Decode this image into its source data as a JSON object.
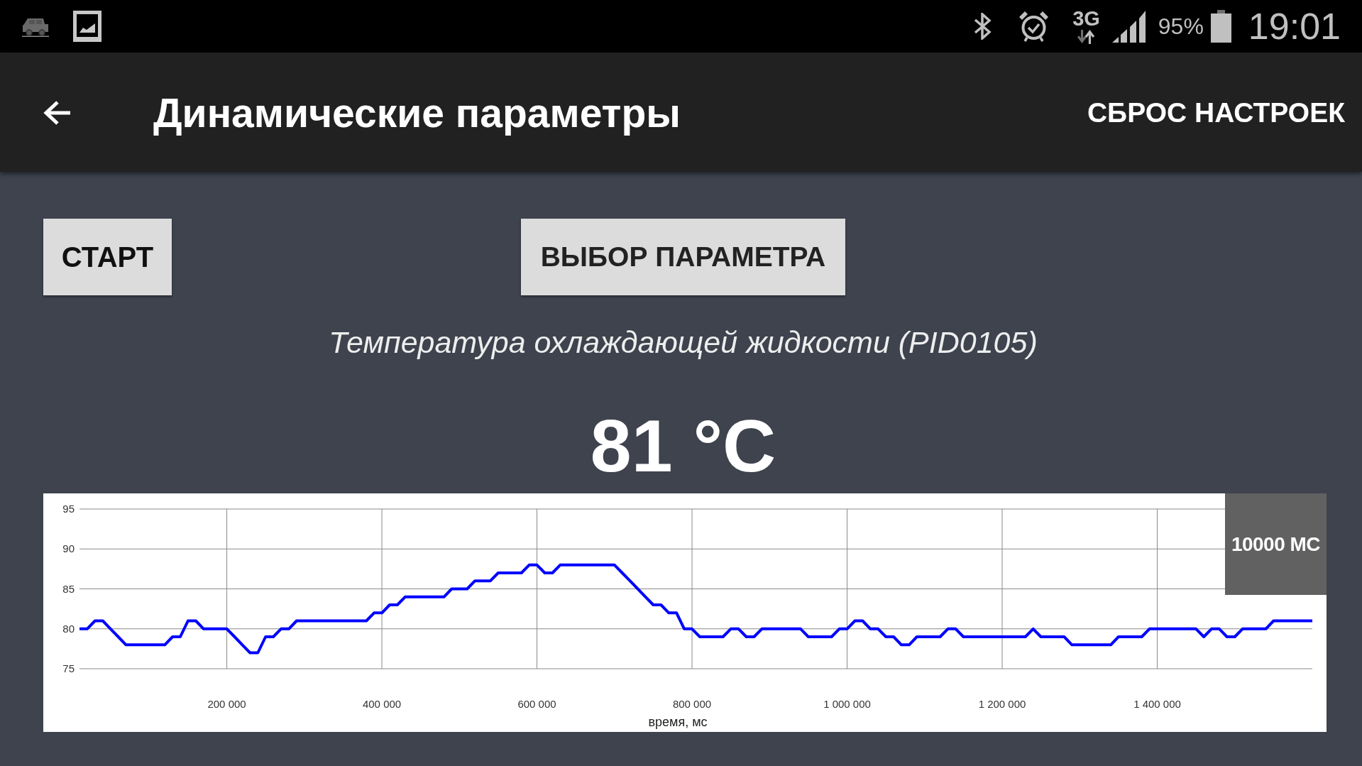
{
  "status_bar": {
    "network": "3G",
    "battery": "95%",
    "time": "19:01"
  },
  "app_bar": {
    "title": "Динамические параметры",
    "action": "СБРОС НАСТРОЕК"
  },
  "toolbar": {
    "start_button": "СТАРТ",
    "select_button": "ВЫБОР ПАРАМЕТРА"
  },
  "parameter": {
    "name": "Температура охлаждающей жидкости (PID0105)",
    "value": "81 °C"
  },
  "chart": {
    "interval": "10000 МС",
    "chart_data": {
      "type": "line",
      "xlabel": "время, мс",
      "grid": true,
      "xlim": [
        10000,
        1600000
      ],
      "ylim": [
        75,
        95
      ],
      "xticks": [
        {
          "value": 200000,
          "label": "200 000"
        },
        {
          "value": 400000,
          "label": "400 000"
        },
        {
          "value": 600000,
          "label": "600 000"
        },
        {
          "value": 800000,
          "label": "800 000"
        },
        {
          "value": 1000000,
          "label": "1 000 000"
        },
        {
          "value": 1200000,
          "label": "1 200 000"
        },
        {
          "value": 1400000,
          "label": "1 400 000"
        }
      ],
      "yticks": [
        75,
        80,
        85,
        90,
        95
      ],
      "x": [
        10000,
        20000,
        30000,
        40000,
        50000,
        60000,
        70000,
        80000,
        90000,
        100000,
        110000,
        120000,
        130000,
        140000,
        150000,
        160000,
        170000,
        180000,
        190000,
        200000,
        210000,
        220000,
        230000,
        240000,
        250000,
        260000,
        270000,
        280000,
        290000,
        300000,
        310000,
        320000,
        330000,
        340000,
        350000,
        360000,
        370000,
        380000,
        390000,
        400000,
        410000,
        420000,
        430000,
        440000,
        450000,
        460000,
        470000,
        480000,
        490000,
        500000,
        510000,
        520000,
        530000,
        540000,
        550000,
        560000,
        570000,
        580000,
        590000,
        600000,
        610000,
        620000,
        630000,
        640000,
        650000,
        660000,
        670000,
        680000,
        690000,
        700000,
        710000,
        720000,
        730000,
        740000,
        750000,
        760000,
        770000,
        780000,
        790000,
        800000,
        810000,
        820000,
        830000,
        840000,
        850000,
        860000,
        870000,
        880000,
        890000,
        900000,
        910000,
        920000,
        930000,
        940000,
        950000,
        960000,
        970000,
        980000,
        990000,
        1000000,
        1010000,
        1020000,
        1030000,
        1040000,
        1050000,
        1060000,
        1070000,
        1080000,
        1090000,
        1100000,
        1110000,
        1120000,
        1130000,
        1140000,
        1150000,
        1160000,
        1170000,
        1180000,
        1190000,
        1200000,
        1210000,
        1220000,
        1230000,
        1240000,
        1250000,
        1260000,
        1270000,
        1280000,
        1290000,
        1300000,
        1310000,
        1320000,
        1330000,
        1340000,
        1350000,
        1360000,
        1370000,
        1380000,
        1390000,
        1400000,
        1410000,
        1420000,
        1430000,
        1440000,
        1450000,
        1460000,
        1470000,
        1480000,
        1490000,
        1500000,
        1510000,
        1520000,
        1530000,
        1540000,
        1550000,
        1560000,
        1570000,
        1580000,
        1590000,
        1600000
      ],
      "series": [
        {
          "color": "#0000ff",
          "values": [
            80,
            80,
            81,
            81,
            80,
            79,
            78,
            78,
            78,
            78,
            78,
            78,
            79,
            79,
            81,
            81,
            80,
            80,
            80,
            80,
            79,
            78,
            77,
            77,
            79,
            79,
            80,
            80,
            81,
            81,
            81,
            81,
            81,
            81,
            81,
            81,
            81,
            81,
            82,
            82,
            83,
            83,
            84,
            84,
            84,
            84,
            84,
            84,
            85,
            85,
            85,
            86,
            86,
            86,
            87,
            87,
            87,
            87,
            88,
            88,
            87,
            87,
            88,
            88,
            88,
            88,
            88,
            88,
            88,
            88,
            87,
            86,
            85,
            84,
            83,
            83,
            82,
            82,
            80,
            80,
            79,
            79,
            79,
            79,
            80,
            80,
            79,
            79,
            80,
            80,
            80,
            80,
            80,
            80,
            79,
            79,
            79,
            79,
            80,
            80,
            81,
            81,
            80,
            80,
            79,
            79,
            78,
            78,
            79,
            79,
            79,
            79,
            80,
            80,
            79,
            79,
            79,
            79,
            79,
            79,
            79,
            79,
            79,
            80,
            79,
            79,
            79,
            79,
            78,
            78,
            78,
            78,
            78,
            78,
            79,
            79,
            79,
            79,
            80,
            80,
            80,
            80,
            80,
            80,
            80,
            79,
            80,
            80,
            79,
            79,
            80,
            80,
            80,
            80,
            81,
            81,
            81,
            81,
            81,
            81
          ]
        }
      ]
    }
  }
}
